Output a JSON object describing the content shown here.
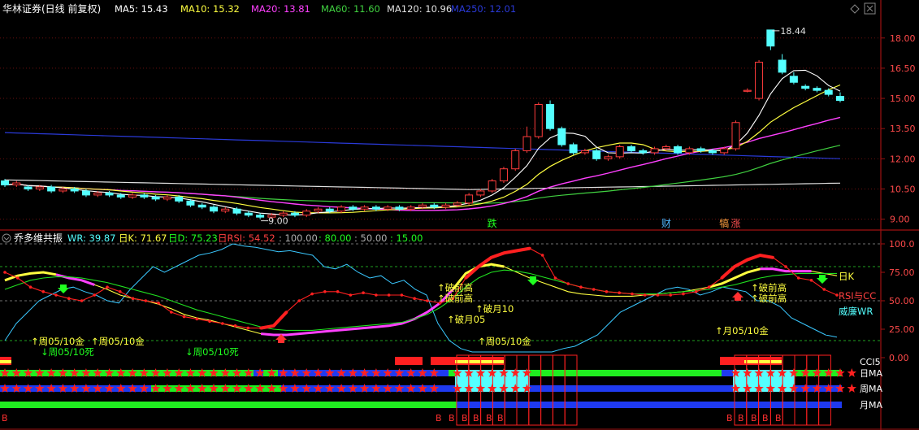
{
  "colors": {
    "bg": "#000000",
    "up": "#ff3c3c",
    "down": "#54ffff",
    "ma5": "#ffffff",
    "ma10": "#ffff40",
    "ma20": "#ff40ff",
    "ma60": "#40d040",
    "ma120": "#e0e0e0",
    "ma250": "#2a3ad8",
    "axis": "#a01010"
  },
  "header": {
    "title": "华林证券(日线 前复权)",
    "ma5": "MA5: 15.43",
    "ma10": "MA10: 15.32",
    "ma20": "MA20: 13.81",
    "ma60": "MA60: 11.60",
    "ma120": "MA120: 10.96",
    "ma250": "MA250: 12.01"
  },
  "sub_header": {
    "title": "乔多维共振",
    "wr": "WR: 39.87",
    "k": "日K: 71.67",
    "d": "日D: 75.23",
    "rsi": "日RSI: 54.52",
    "l100": ": 100.00",
    "l80": ": 80.00",
    "l50": ": 50.00",
    "l15": ": 15.00"
  },
  "chart_data": [
    {
      "type": "candlestick",
      "y_ticks": [
        "18.00",
        "16.50",
        "15.00",
        "13.50",
        "12.00",
        "10.50",
        "9.00"
      ],
      "ylim": [
        8.5,
        19.0
      ],
      "candles": [
        [
          10.9,
          10.7,
          11.0,
          10.6
        ],
        [
          10.7,
          10.8,
          10.9,
          10.6
        ],
        [
          10.6,
          10.5,
          10.7,
          10.4
        ],
        [
          10.5,
          10.6,
          10.7,
          10.4
        ],
        [
          10.6,
          10.4,
          10.7,
          10.3
        ],
        [
          10.4,
          10.5,
          10.6,
          10.3
        ],
        [
          10.5,
          10.4,
          10.6,
          10.3
        ],
        [
          10.4,
          10.2,
          10.5,
          10.1
        ],
        [
          10.2,
          10.3,
          10.4,
          10.1
        ],
        [
          10.3,
          10.2,
          10.4,
          10.1
        ],
        [
          10.2,
          10.1,
          10.3,
          10.0
        ],
        [
          10.1,
          10.2,
          10.3,
          10.0
        ],
        [
          10.2,
          10.1,
          10.3,
          10.0
        ],
        [
          10.1,
          10.0,
          10.2,
          9.9
        ],
        [
          10.0,
          10.1,
          10.2,
          9.9
        ],
        [
          10.1,
          9.9,
          10.2,
          9.8
        ],
        [
          9.9,
          9.7,
          10.0,
          9.6
        ],
        [
          9.7,
          9.6,
          9.8,
          9.5
        ],
        [
          9.6,
          9.4,
          9.7,
          9.3
        ],
        [
          9.4,
          9.5,
          9.6,
          9.3
        ],
        [
          9.5,
          9.3,
          9.6,
          9.2
        ],
        [
          9.3,
          9.2,
          9.4,
          9.1
        ],
        [
          9.2,
          9.1,
          9.3,
          9.0
        ],
        [
          9.1,
          9.2,
          9.3,
          9.0
        ],
        [
          9.2,
          9.3,
          9.4,
          9.1
        ],
        [
          9.3,
          9.2,
          9.4,
          9.1
        ],
        [
          9.2,
          9.4,
          9.5,
          9.1
        ],
        [
          9.4,
          9.5,
          9.6,
          9.3
        ],
        [
          9.5,
          9.4,
          9.6,
          9.3
        ],
        [
          9.4,
          9.6,
          9.7,
          9.3
        ],
        [
          9.6,
          9.5,
          9.7,
          9.4
        ],
        [
          9.5,
          9.6,
          9.7,
          9.4
        ],
        [
          9.6,
          9.5,
          9.7,
          9.4
        ],
        [
          9.5,
          9.6,
          9.7,
          9.4
        ],
        [
          9.6,
          9.5,
          9.7,
          9.4
        ],
        [
          9.5,
          9.6,
          9.7,
          9.4
        ],
        [
          9.6,
          9.7,
          9.8,
          9.5
        ],
        [
          9.7,
          9.6,
          9.8,
          9.5
        ],
        [
          9.6,
          9.7,
          9.8,
          9.5
        ],
        [
          9.7,
          9.8,
          9.9,
          9.6
        ],
        [
          9.8,
          10.2,
          10.3,
          9.7
        ],
        [
          10.2,
          10.4,
          10.5,
          10.1
        ],
        [
          10.4,
          10.9,
          11.0,
          10.3
        ],
        [
          10.9,
          11.5,
          11.6,
          10.8
        ],
        [
          11.5,
          12.4,
          12.5,
          11.4
        ],
        [
          12.4,
          13.1,
          13.6,
          12.3
        ],
        [
          13.1,
          14.7,
          14.8,
          13.0
        ],
        [
          14.7,
          13.5,
          14.9,
          13.4
        ],
        [
          13.5,
          12.7,
          13.6,
          12.6
        ],
        [
          12.7,
          12.3,
          12.8,
          12.2
        ],
        [
          12.3,
          12.4,
          12.5,
          12.2
        ],
        [
          12.4,
          12.0,
          12.5,
          11.9
        ],
        [
          12.0,
          12.1,
          12.2,
          11.9
        ],
        [
          12.1,
          12.6,
          12.7,
          12.0
        ],
        [
          12.6,
          12.4,
          12.7,
          12.3
        ],
        [
          12.4,
          12.3,
          12.5,
          12.2
        ],
        [
          12.3,
          12.5,
          12.6,
          12.2
        ],
        [
          12.5,
          12.6,
          12.7,
          12.4
        ],
        [
          12.6,
          12.3,
          12.7,
          12.2
        ],
        [
          12.3,
          12.5,
          12.6,
          12.2
        ],
        [
          12.5,
          12.4,
          12.6,
          12.3
        ],
        [
          12.4,
          12.3,
          12.5,
          12.2
        ],
        [
          12.3,
          12.5,
          12.6,
          12.2
        ],
        [
          12.5,
          13.8,
          13.9,
          12.4
        ],
        [
          15.4,
          15.4,
          15.5,
          15.3
        ],
        [
          15.0,
          16.8,
          16.9,
          14.9
        ],
        [
          18.4,
          17.6,
          18.4,
          17.4
        ],
        [
          16.9,
          16.3,
          17.2,
          16.2
        ],
        [
          16.1,
          15.8,
          16.3,
          15.7
        ],
        [
          15.6,
          15.5,
          15.7,
          15.4
        ],
        [
          15.5,
          15.4,
          15.6,
          15.3
        ],
        [
          15.4,
          15.2,
          15.5,
          15.1
        ],
        [
          15.1,
          14.9,
          15.3,
          14.8
        ]
      ],
      "ma_labels": {
        "hi": "18.44",
        "lo": "9.00"
      },
      "events": [
        {
          "i": 42,
          "text": "跌",
          "color": "#20ff20"
        },
        {
          "i": 57,
          "text": "财",
          "color": "#4fb8ff"
        },
        {
          "i": 62,
          "text": "犒",
          "color": "#ff9f40"
        },
        {
          "i": 63,
          "text": "涨",
          "color": "#ff5050"
        }
      ]
    },
    {
      "type": "line",
      "y_ticks": [
        "100.0",
        "75.00",
        "50.00",
        "25.00",
        "0.00"
      ],
      "ylim": [
        0,
        100
      ],
      "ref_lines": [
        100,
        80,
        50,
        15
      ],
      "right_labels": [
        {
          "text": "日K",
          "color": "#ffff40"
        },
        {
          "text": "RSI与CC",
          "color": "#ff4040"
        },
        {
          "text": "威廉WR",
          "color": "#54ffff"
        }
      ],
      "annotations": [
        {
          "text": "↑周05/10金",
          "x": 38,
          "y": 424,
          "color": "#ffff40"
        },
        {
          "text": "↓周05/10死",
          "x": 50,
          "y": 437,
          "color": "#20ff20"
        },
        {
          "text": "↑周05/10金",
          "x": 112,
          "y": 424,
          "color": "#ffff40"
        },
        {
          "text": "↓周05/10死",
          "x": 228,
          "y": 437,
          "color": "#20ff20"
        },
        {
          "text": "↑破前高",
          "x": 538,
          "y": 358,
          "color": "#ffff40"
        },
        {
          "text": "↑破前高",
          "x": 538,
          "y": 371,
          "color": "#ffff40"
        },
        {
          "text": "↑破月10",
          "x": 585,
          "y": 384,
          "color": "#ffff40"
        },
        {
          "text": "↑破月05",
          "x": 550,
          "y": 397,
          "color": "#ffff40"
        },
        {
          "text": "↑周05/10金",
          "x": 588,
          "y": 424,
          "color": "#ffff40"
        },
        {
          "text": "↑破前高",
          "x": 924,
          "y": 358,
          "color": "#ffff40"
        },
        {
          "text": "↑破前高",
          "x": 924,
          "y": 371,
          "color": "#ffff40"
        },
        {
          "text": "↑月05/10金",
          "x": 880,
          "y": 411,
          "color": "#ffff40"
        }
      ],
      "series": [
        {
          "key": "WR",
          "values": [
            15,
            30,
            40,
            50,
            55,
            60,
            62,
            58,
            55,
            50,
            48,
            60,
            70,
            80,
            75,
            80,
            85,
            90,
            92,
            95,
            100,
            98,
            97,
            95,
            93,
            94,
            92,
            90,
            80,
            78,
            82,
            75,
            70,
            72,
            65,
            68,
            60,
            55,
            30,
            15,
            8,
            5,
            5,
            5,
            5,
            5,
            5,
            5,
            5,
            8,
            10,
            15,
            20,
            30,
            40,
            45,
            50,
            55,
            60,
            62,
            60,
            55,
            58,
            62,
            60,
            58,
            50,
            50,
            45,
            35,
            30,
            25,
            20,
            18
          ]
        },
        {
          "key": "K",
          "values": [
            68,
            72,
            74,
            75,
            73,
            70,
            68,
            64,
            60,
            55,
            52,
            50,
            47,
            43,
            38,
            35,
            33,
            30,
            27,
            24,
            21,
            20,
            20,
            21,
            22,
            23,
            24,
            25,
            26,
            27,
            28,
            30,
            34,
            40,
            48,
            60,
            74,
            80,
            82,
            80,
            75,
            70,
            66,
            62,
            58,
            56,
            55,
            54,
            54,
            54,
            55,
            56,
            57,
            58,
            60,
            62,
            65,
            70,
            75,
            78,
            78,
            76,
            76,
            76,
            74,
            72
          ]
        },
        {
          "key": "D",
          "values": [
            60,
            64,
            68,
            70,
            71,
            71,
            70,
            68,
            66,
            63,
            60,
            57,
            54,
            50,
            46,
            42,
            39,
            36,
            33,
            30,
            27,
            25,
            24,
            24,
            24,
            25,
            26,
            27,
            28,
            29,
            30,
            31,
            34,
            38,
            44,
            52,
            62,
            70,
            75,
            77,
            76,
            74,
            71,
            68,
            65,
            62,
            60,
            58,
            57,
            56,
            56,
            56,
            57,
            58,
            59,
            60,
            62,
            64,
            67,
            70,
            72,
            73,
            74,
            74,
            74,
            74
          ]
        },
        {
          "key": "RSI",
          "values": [
            75,
            70,
            62,
            58,
            55,
            52,
            50,
            55,
            62,
            58,
            52,
            50,
            48,
            40,
            36,
            34,
            32,
            30,
            28,
            26,
            26,
            28,
            40,
            50,
            56,
            58,
            58,
            55,
            57,
            55,
            55,
            55,
            52,
            50,
            48,
            52,
            70,
            80,
            88,
            92,
            94,
            96,
            90,
            70,
            65,
            62,
            60,
            58,
            57,
            56,
            55,
            55,
            55,
            56,
            58,
            62,
            70,
            80,
            86,
            90,
            88,
            80,
            70,
            68,
            60,
            55
          ]
        }
      ]
    }
  ],
  "bottom_rows": [
    {
      "label": "CCI5",
      "color": "#ffffff"
    },
    {
      "label": "日MA",
      "color": "#ffffff"
    },
    {
      "label": "周MA",
      "color": "#ffffff"
    },
    {
      "label": "月MA",
      "color": "#ffffff"
    }
  ],
  "b_marker": "B"
}
